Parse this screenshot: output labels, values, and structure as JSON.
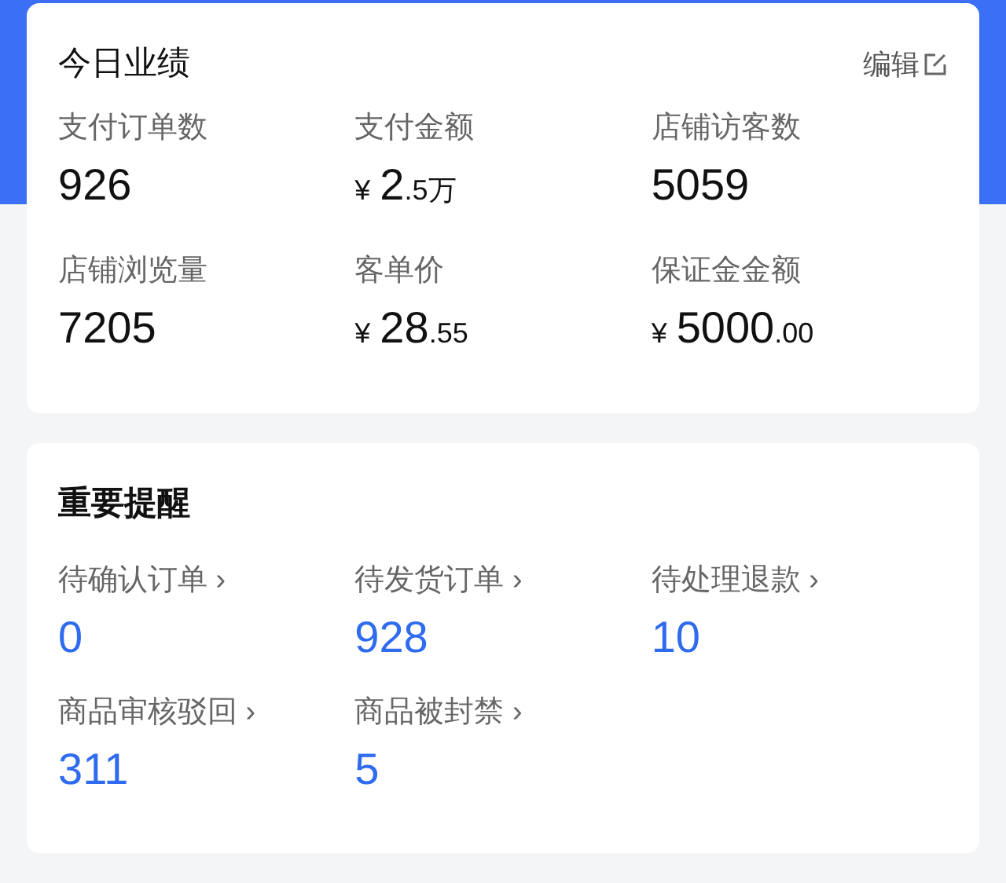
{
  "performance": {
    "title": "今日业绩",
    "edit_label": "编辑",
    "metrics": [
      {
        "label": "支付订单数",
        "value": "926"
      },
      {
        "label": "支付金额",
        "currency": "¥",
        "value": "2",
        "suffix": ".5万"
      },
      {
        "label": "店铺访客数",
        "value": "5059"
      },
      {
        "label": "店铺浏览量",
        "value": "7205"
      },
      {
        "label": "客单价",
        "currency": "¥",
        "value": "28",
        "suffix": ".55"
      },
      {
        "label": "保证金金额",
        "currency": "¥",
        "value": "5000",
        "suffix": ".00"
      }
    ]
  },
  "reminders": {
    "title": "重要提醒",
    "arrow": "›",
    "items": [
      {
        "label": "待确认订单",
        "value": "0"
      },
      {
        "label": "待发货订单",
        "value": "928"
      },
      {
        "label": "待处理退款",
        "value": "10"
      },
      {
        "label": "商品审核驳回",
        "value": "311"
      },
      {
        "label": "商品被封禁",
        "value": "5"
      }
    ]
  }
}
